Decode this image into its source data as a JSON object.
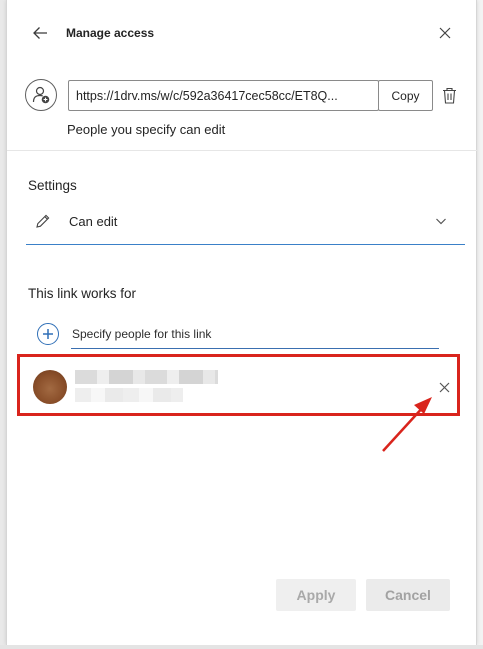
{
  "header": {
    "title": "Manage access",
    "back_icon": "arrow-left-icon",
    "close_icon": "close-icon"
  },
  "link": {
    "url": "https://1drv.ms/w/c/592a36417cec58cc/ET8Q...",
    "copy_label": "Copy",
    "description": "People you specify can edit",
    "link_icon": "link-settings-icon",
    "delete_icon": "trash-icon"
  },
  "settings": {
    "title": "Settings",
    "permission": "Can edit",
    "permission_icon": "pencil-icon",
    "dropdown_icon": "chevron-down-icon"
  },
  "recipients": {
    "title": "This link works for",
    "add_icon": "add-icon",
    "input_placeholder": "Specify people for this link",
    "remove_icon": "remove-person-icon"
  },
  "footer": {
    "apply_label": "Apply",
    "cancel_label": "Cancel"
  },
  "annotation": {
    "color": "#d9241c"
  }
}
